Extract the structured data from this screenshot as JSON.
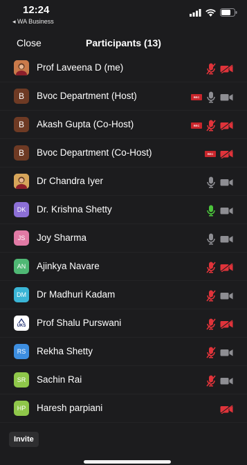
{
  "status_bar": {
    "time": "12:24",
    "back_app": "◂ WA Business"
  },
  "header": {
    "close_label": "Close",
    "title": "Participants (13)"
  },
  "colors": {
    "mic_off": "#e0333a",
    "mic_on": "#4bc33b",
    "icon_gray": "#8e8e93",
    "rec": "#c9262c"
  },
  "participants": [
    {
      "name": "Prof Laveena D (me)",
      "avatar": "photo",
      "initials": "",
      "avatar_color": "#c97a4a",
      "rec": false,
      "mic": "off",
      "video": "off"
    },
    {
      "name": "Bvoc Department (Host)",
      "avatar": "letter",
      "initials": "B",
      "avatar_color": "#6e3a24",
      "rec": true,
      "mic": "on_gray",
      "video": "on_gray"
    },
    {
      "name": "Akash Gupta (Co-Host)",
      "avatar": "letter",
      "initials": "B",
      "avatar_color": "#6e3a24",
      "rec": true,
      "mic": "off",
      "video": "off"
    },
    {
      "name": "Bvoc Department (Co-Host)",
      "avatar": "letter",
      "initials": "B",
      "avatar_color": "#6e3a24",
      "rec": true,
      "mic": "none",
      "video": "off"
    },
    {
      "name": "Dr Chandra Iyer",
      "avatar": "photo",
      "initials": "",
      "avatar_color": "#d6a55a",
      "rec": false,
      "mic": "on_gray",
      "video": "on_gray"
    },
    {
      "name": "Dr. Krishna Shetty",
      "avatar": "initials",
      "initials": "DK",
      "avatar_color": "#8c6fd6",
      "rec": false,
      "mic": "on_green",
      "video": "on_gray"
    },
    {
      "name": "Joy Sharma",
      "avatar": "initials",
      "initials": "JS",
      "avatar_color": "#e17aa5",
      "rec": false,
      "mic": "on_gray",
      "video": "on_gray"
    },
    {
      "name": "Ajinkya Navare",
      "avatar": "initials",
      "initials": "AN",
      "avatar_color": "#4fb874",
      "rec": false,
      "mic": "off",
      "video": "off"
    },
    {
      "name": "Dr Madhuri Kadam",
      "avatar": "initials",
      "initials": "DM",
      "avatar_color": "#3ab5d6",
      "rec": false,
      "mic": "off",
      "video": "on_gray"
    },
    {
      "name": "Prof Shalu Purswani",
      "avatar": "logo",
      "initials": "UKS",
      "avatar_color": "#ffffff",
      "rec": false,
      "mic": "off",
      "video": "off"
    },
    {
      "name": "Rekha Shetty",
      "avatar": "initials",
      "initials": "RS",
      "avatar_color": "#3d8ee0",
      "rec": false,
      "mic": "off",
      "video": "on_gray"
    },
    {
      "name": "Sachin Rai",
      "avatar": "initials",
      "initials": "SR",
      "avatar_color": "#8fc74a",
      "rec": false,
      "mic": "off",
      "video": "on_gray"
    },
    {
      "name": "Haresh parpiani",
      "avatar": "initials",
      "initials": "HP",
      "avatar_color": "#8fc74a",
      "rec": false,
      "mic": "none",
      "video": "off"
    }
  ],
  "footer": {
    "invite_label": "Invite"
  }
}
